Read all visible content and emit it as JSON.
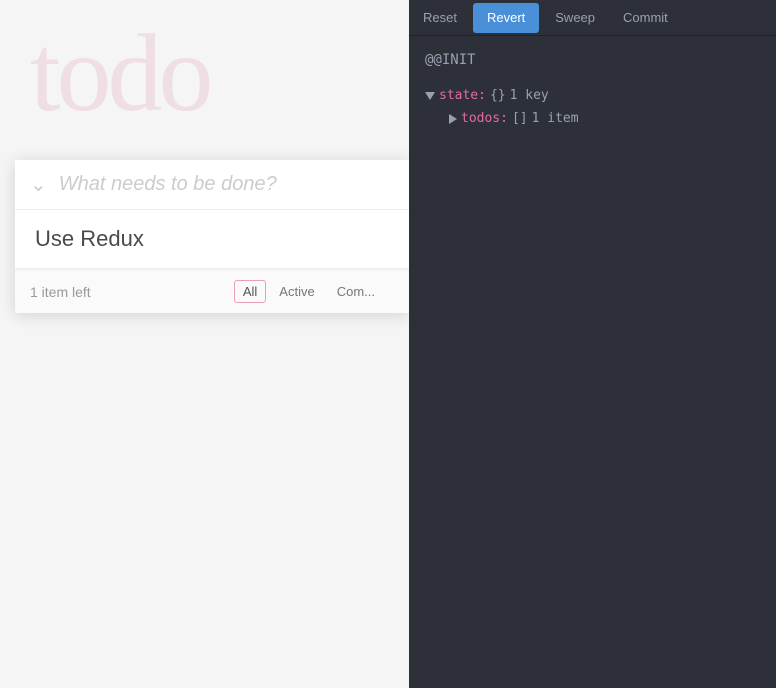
{
  "left": {
    "watermark": "todo",
    "input_placeholder": "What needs to be done?",
    "todo_item": "Use Redux",
    "footer": {
      "count_label": "1 item left",
      "filters": [
        {
          "label": "All",
          "active": true
        },
        {
          "label": "Active",
          "active": false
        },
        {
          "label": "Com...",
          "active": false
        }
      ]
    }
  },
  "right": {
    "toolbar": {
      "buttons": [
        {
          "label": "Reset",
          "selected": false
        },
        {
          "label": "Revert",
          "selected": true
        },
        {
          "label": "Sweep",
          "selected": false
        },
        {
          "label": "Commit",
          "selected": false
        }
      ]
    },
    "init_label": "@@INIT",
    "tree": {
      "root_key": "state:",
      "root_bracket_open": "{}",
      "root_meta": "1 key",
      "child_key": "todos:",
      "child_bracket_open": "[]",
      "child_meta": "1 item"
    }
  }
}
